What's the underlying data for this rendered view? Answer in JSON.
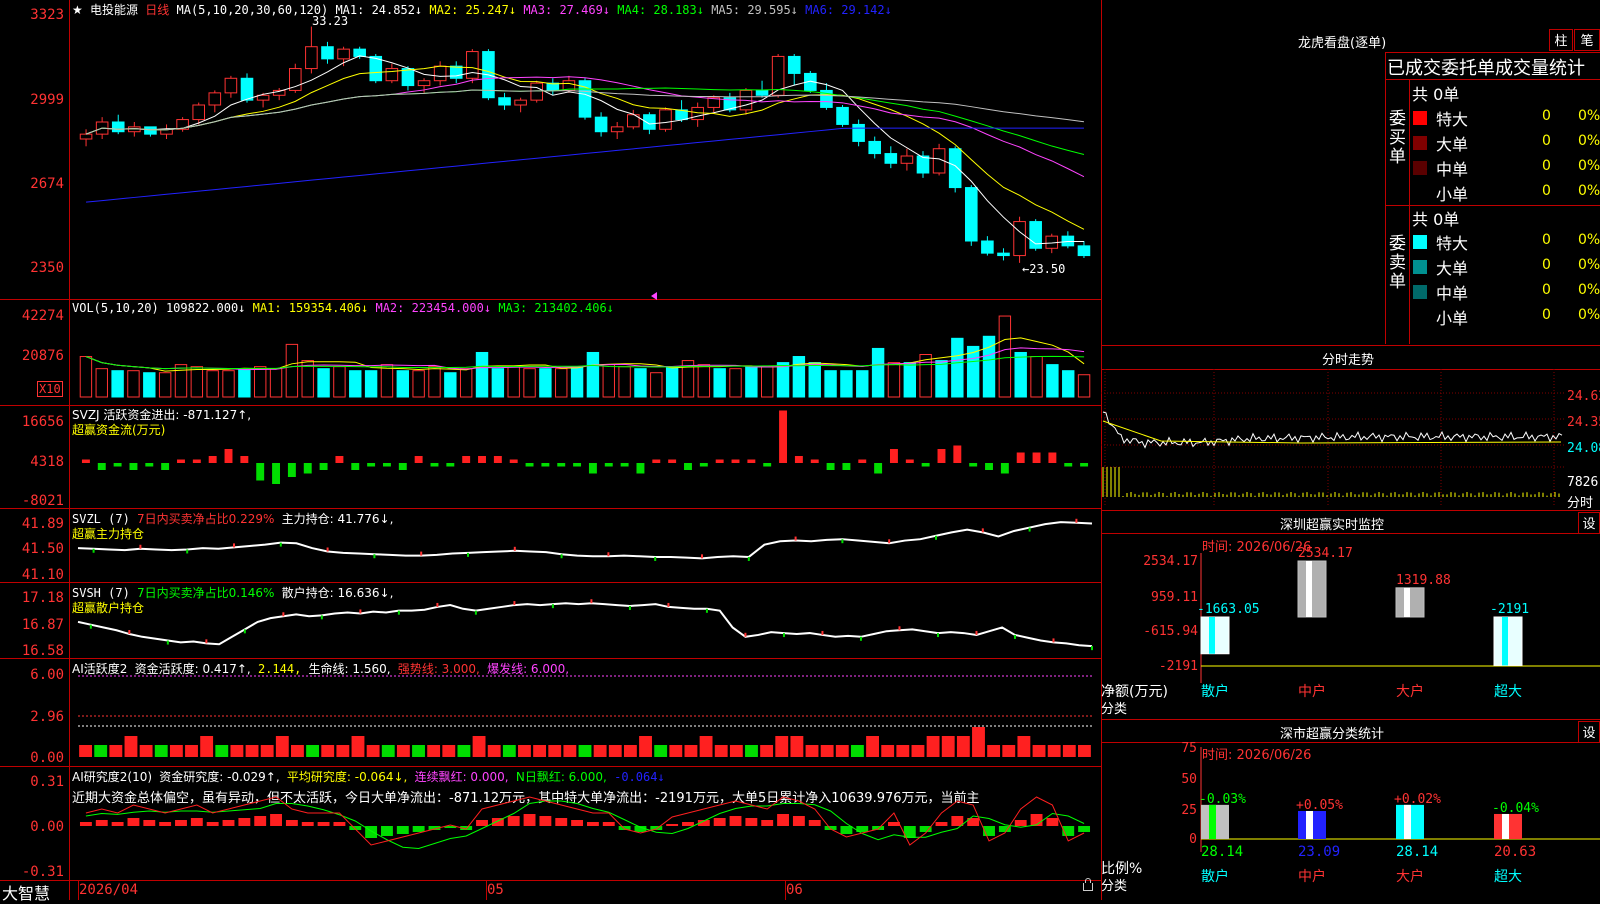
{
  "header": {
    "star": "★",
    "stock_name": "电投能源",
    "period": "日线",
    "ma_label": "MA(5,10,20,30,60,120)",
    "mas": [
      {
        "label": "MA1: 24.852↓",
        "color": "#ffffff"
      },
      {
        "label": "MA2: 25.247↓",
        "color": "#ffff00"
      },
      {
        "label": "MA3: 27.469↓",
        "color": "#ff44ff"
      },
      {
        "label": "MA4: 28.183↓",
        "color": "#00ff00"
      },
      {
        "label": "MA5: 29.595↓",
        "color": "#c0c0c0"
      },
      {
        "label": "MA6: 29.142↓",
        "color": "#2222ff"
      }
    ]
  },
  "main_chart": {
    "y_labels": [
      "3323",
      "2999",
      "2674",
      "2350"
    ],
    "high_mark": "33.23",
    "low_mark": "←23.50",
    "colors": {
      "up": "#ff3333",
      "down": "#00ffff",
      "ma1": "#ffffff",
      "ma2": "#ffff00",
      "ma3": "#ff44ff",
      "ma4": "#00ff00",
      "ma5": "#c0c0c0",
      "ma6": "#2222ff"
    }
  },
  "chart_data": {
    "type": "candlestick",
    "candles": [
      [
        28.6,
        29.0,
        28.3,
        28.8
      ],
      [
        28.8,
        29.5,
        28.6,
        29.3
      ],
      [
        29.3,
        29.6,
        28.8,
        28.9
      ],
      [
        28.9,
        29.3,
        28.7,
        29.1
      ],
      [
        29.1,
        29.1,
        28.7,
        28.8
      ],
      [
        28.8,
        29.2,
        28.6,
        29.0
      ],
      [
        29.0,
        29.5,
        28.9,
        29.4
      ],
      [
        29.4,
        30.1,
        29.2,
        30.0
      ],
      [
        30.0,
        30.6,
        29.7,
        30.5
      ],
      [
        30.5,
        31.2,
        30.3,
        31.1
      ],
      [
        31.1,
        31.3,
        30.1,
        30.2
      ],
      [
        30.2,
        30.5,
        29.9,
        30.4
      ],
      [
        30.4,
        30.7,
        30.2,
        30.6
      ],
      [
        30.6,
        31.7,
        30.5,
        31.5
      ],
      [
        31.5,
        33.23,
        31.3,
        32.4
      ],
      [
        32.4,
        32.6,
        31.7,
        31.9
      ],
      [
        31.9,
        32.4,
        31.6,
        32.3
      ],
      [
        32.3,
        32.4,
        31.9,
        32.0
      ],
      [
        32.0,
        32.1,
        30.9,
        31.0
      ],
      [
        31.0,
        31.7,
        30.9,
        31.5
      ],
      [
        31.5,
        31.6,
        30.6,
        30.8
      ],
      [
        30.8,
        31.1,
        30.5,
        31.0
      ],
      [
        31.0,
        31.8,
        30.8,
        31.6
      ],
      [
        31.6,
        31.8,
        30.9,
        31.1
      ],
      [
        31.1,
        32.3,
        30.9,
        32.2
      ],
      [
        32.2,
        32.3,
        30.2,
        30.3
      ],
      [
        30.3,
        30.5,
        29.8,
        30.0
      ],
      [
        30.0,
        30.3,
        29.7,
        30.2
      ],
      [
        30.2,
        31.0,
        30.1,
        30.9
      ],
      [
        30.9,
        31.1,
        30.4,
        30.6
      ],
      [
        30.6,
        31.2,
        30.5,
        31.0
      ],
      [
        31.0,
        31.1,
        29.4,
        29.5
      ],
      [
        29.5,
        29.7,
        28.7,
        28.9
      ],
      [
        28.9,
        29.3,
        28.6,
        29.1
      ],
      [
        29.1,
        29.8,
        29.0,
        29.6
      ],
      [
        29.6,
        29.7,
        28.8,
        29.0
      ],
      [
        29.0,
        29.9,
        28.9,
        29.8
      ],
      [
        29.8,
        30.2,
        29.3,
        29.4
      ],
      [
        29.4,
        30.1,
        29.1,
        29.9
      ],
      [
        29.9,
        30.4,
        29.7,
        30.3
      ],
      [
        30.3,
        30.5,
        29.7,
        29.8
      ],
      [
        29.8,
        30.7,
        29.6,
        30.6
      ],
      [
        30.6,
        31.0,
        30.3,
        30.4
      ],
      [
        30.4,
        32.1,
        30.3,
        32.0
      ],
      [
        32.0,
        32.1,
        30.8,
        31.3
      ],
      [
        31.3,
        31.4,
        30.5,
        30.6
      ],
      [
        30.6,
        30.9,
        29.8,
        29.9
      ],
      [
        29.9,
        30.0,
        29.1,
        29.2
      ],
      [
        29.2,
        29.4,
        28.3,
        28.5
      ],
      [
        28.5,
        28.7,
        27.8,
        28.0
      ],
      [
        28.0,
        28.3,
        27.4,
        27.6
      ],
      [
        27.6,
        28.2,
        27.3,
        27.9
      ],
      [
        27.9,
        28.1,
        27.0,
        27.2
      ],
      [
        27.2,
        28.4,
        27.1,
        28.2
      ],
      [
        28.2,
        28.3,
        26.4,
        26.6
      ],
      [
        26.6,
        26.7,
        24.2,
        24.4
      ],
      [
        24.4,
        24.6,
        23.8,
        23.9
      ],
      [
        23.9,
        24.1,
        23.6,
        23.8
      ],
      [
        23.8,
        25.4,
        23.5,
        25.2
      ],
      [
        25.2,
        25.3,
        24.0,
        24.1
      ],
      [
        24.1,
        24.7,
        23.9,
        24.6
      ],
      [
        24.6,
        24.8,
        24.1,
        24.2
      ],
      [
        24.2,
        24.4,
        23.7,
        23.8
      ]
    ],
    "y_range": [
      23.0,
      33.5
    ]
  },
  "vol": {
    "label": "VOL(5,10,20)",
    "items": [
      {
        "text": "109822.000↓",
        "color": "#ffffff"
      },
      {
        "text": "MA1: 159354.406↓",
        "color": "#ffff00"
      },
      {
        "text": "MA2: 223454.000↓",
        "color": "#ff44ff"
      },
      {
        "text": "MA3: 213402.406↓",
        "color": "#00ff00"
      }
    ],
    "y_labels": [
      "42274",
      "20876"
    ],
    "unit": "X10",
    "values": [
      20,
      14,
      13,
      13,
      12,
      12,
      16,
      15,
      13,
      13,
      14,
      15,
      14,
      26,
      18,
      14,
      15,
      13,
      13,
      16,
      13,
      13,
      15,
      12,
      14,
      22,
      14,
      15,
      14,
      14,
      14,
      15,
      22,
      16,
      15,
      14,
      12,
      15,
      18,
      16,
      14,
      14,
      15,
      15,
      17,
      20,
      17,
      13,
      13,
      13,
      24,
      17,
      17,
      21,
      18,
      29,
      25,
      30,
      40,
      22,
      20,
      16,
      13,
      11
    ]
  },
  "svzj": {
    "label": "SVZJ  活跃资金进出: -871.127↑,",
    "sub": "超赢资金流(万元)",
    "y_labels": [
      "16656",
      "4318",
      "-8021"
    ],
    "values": [
      1,
      -2,
      -1,
      -2,
      -1,
      -2,
      1,
      1,
      2,
      4,
      2,
      -5,
      -6,
      -4,
      -3,
      -2,
      2,
      -2,
      -1,
      -1,
      -2,
      2,
      -1,
      -1,
      2,
      2,
      2,
      1,
      -1,
      -1,
      -1,
      -1,
      -3,
      -1,
      -1,
      -3,
      1,
      1,
      -2,
      -1,
      1,
      1,
      1,
      -1,
      15,
      2,
      1,
      -2,
      -2,
      1,
      -3,
      4,
      1,
      -1,
      4,
      5,
      -1,
      -2,
      -3,
      3,
      3,
      3,
      -1,
      -1
    ]
  },
  "svzl": {
    "label": "SVZL (7)",
    "ratio": "7日内买卖净占比0.229%",
    "pos": "主力持仓: 41.776↓,",
    "sub": "超赢主力持仓",
    "y_labels": [
      "41.89",
      "41.50",
      "41.10"
    ],
    "values": [
      41.45,
      41.44,
      41.43,
      41.42,
      41.44,
      41.43,
      41.42,
      41.43,
      41.45,
      41.44,
      41.46,
      41.48,
      41.5,
      41.53,
      41.52,
      41.45,
      41.4,
      41.38,
      41.37,
      41.36,
      41.35,
      41.34,
      41.34,
      41.35,
      41.37,
      41.38,
      41.39,
      41.4,
      41.41,
      41.4,
      41.39,
      41.36,
      41.34,
      41.33,
      41.33,
      41.34,
      41.33,
      41.32,
      41.32,
      41.31,
      41.3,
      41.32,
      41.33,
      41.32,
      41.5,
      41.55,
      41.56,
      41.55,
      41.57,
      41.58,
      41.56,
      41.54,
      41.52,
      41.56,
      41.58,
      41.63,
      41.68,
      41.72,
      41.68,
      41.62,
      41.7,
      41.75,
      41.8,
      41.83,
      41.82,
      41.81
    ]
  },
  "svsh": {
    "label": "SVSH (7)",
    "ratio": "7日内买卖净占比0.146%",
    "pos": "散户持仓: 16.636↓,",
    "sub": "超赢散户持仓",
    "y_labels": [
      "17.18",
      "16.87",
      "16.58"
    ],
    "values": [
      16.86,
      16.83,
      16.8,
      16.77,
      16.73,
      16.7,
      16.68,
      16.66,
      16.64,
      16.65,
      16.63,
      16.62,
      16.7,
      16.78,
      16.86,
      16.9,
      16.92,
      16.94,
      16.92,
      16.93,
      16.95,
      16.96,
      16.95,
      16.97,
      16.96,
      16.98,
      16.98,
      16.99,
      17.02,
      17.04,
      17.0,
      16.98,
      17.0,
      17.02,
      17.04,
      17.05,
      17.04,
      17.05,
      17.06,
      17.05,
      17.06,
      17.05,
      17.04,
      17.03,
      17.04,
      17.05,
      17.02,
      17.01,
      17.0,
      17.0,
      16.98,
      16.8,
      16.7,
      16.72,
      16.75,
      16.74,
      16.73,
      16.74,
      16.72,
      16.7,
      16.71,
      16.7,
      16.73,
      16.76,
      16.77,
      16.78,
      16.76,
      16.74,
      16.75,
      16.74,
      16.72,
      16.76,
      16.8,
      16.72,
      16.69,
      16.66,
      16.64,
      16.63,
      16.61,
      16.6
    ]
  },
  "ai_active": {
    "label": "AI活跃度2",
    "items": [
      {
        "text": "资金活跃度: 0.417↑,",
        "color": "#ffffff"
      },
      {
        "text": "2.144,",
        "color": "#ffff00"
      },
      {
        "text": "生命线: 1.560,",
        "color": "#ffffff"
      },
      {
        "text": "强势线: 3.000,",
        "color": "#ff3333"
      },
      {
        "text": "爆发线: 6.000,",
        "color": "#ff44ff"
      }
    ],
    "y_labels": [
      "6.00",
      "2.96",
      "0.00"
    ],
    "values": [
      1,
      -1,
      1,
      2,
      1,
      -1,
      1,
      1,
      2,
      -1,
      1,
      1,
      1,
      2,
      1,
      -1,
      1,
      1,
      2,
      1,
      -1,
      1,
      -1,
      1,
      1,
      -1,
      2,
      1,
      -1,
      1,
      1,
      1,
      1,
      -1,
      1,
      1,
      1,
      2,
      -1,
      1,
      1,
      2,
      1,
      1,
      -1,
      1,
      2,
      2,
      1,
      1,
      1,
      -1,
      2,
      1,
      1,
      1,
      2,
      2,
      2,
      3,
      1,
      1,
      2,
      1,
      1,
      1,
      1
    ]
  },
  "ai_research": {
    "label": "AI研究度2(10)",
    "items": [
      {
        "text": "资金研究度: -0.029↑,",
        "color": "#ffffff"
      },
      {
        "text": "平均研究度: -0.064↓,",
        "color": "#ffff00"
      },
      {
        "text": "连续飘红: 0.000,",
        "color": "#ff44ff"
      },
      {
        "text": "N日飘红: 6.000,",
        "color": "#00ff00"
      },
      {
        "text": "-0.064↓",
        "color": "#2222ff"
      }
    ],
    "y_labels": [
      "0.31",
      "0.00",
      "-0.31"
    ],
    "comment": "近期大资金总体偏空，虽有异动，但不太活跃，今日大单净流出：-871.12万元，其中特大单净流出：-2191万元，大单5日累计净入10639.976万元，当前主",
    "values": [
      0.02,
      0.03,
      0.02,
      0.04,
      0.03,
      0.02,
      0.03,
      0.04,
      0.02,
      0.03,
      0.04,
      0.05,
      0.06,
      0.03,
      0.02,
      0.02,
      0.02,
      -0.02,
      -0.06,
      -0.05,
      -0.04,
      -0.03,
      -0.02,
      -0.01,
      -0.02,
      0.03,
      0.04,
      0.05,
      0.06,
      0.05,
      0.04,
      0.03,
      0.02,
      0.02,
      -0.02,
      -0.03,
      -0.02,
      0.01,
      0.02,
      0.03,
      0.04,
      0.05,
      0.04,
      0.03,
      0.06,
      0.05,
      0.03,
      -0.02,
      -0.04,
      -0.03,
      -0.02,
      0.02,
      -0.06,
      -0.03,
      0.02,
      0.05,
      0.04,
      -0.05,
      -0.03,
      0.03,
      0.06,
      0.04,
      -0.05,
      -0.03
    ]
  },
  "x_axis": {
    "labels": [
      "2026/04",
      "05",
      "06"
    ]
  },
  "footer": {
    "app": "大智慧"
  },
  "right": {
    "lhb": {
      "title": "龙虎看盘(逐单)",
      "btn1": "柱",
      "btn2": "笔",
      "header": "已成交委托单成交量统计",
      "buy_label": "委买单",
      "sell_label": "委卖单",
      "buy_total": "共 0单",
      "sell_total": "共 0单",
      "buy_rows": [
        {
          "name": "特大",
          "val": "0",
          "pct": "0%",
          "color": "#ff0000"
        },
        {
          "name": "大单",
          "val": "0",
          "pct": "0%",
          "color": "#800000"
        },
        {
          "name": "中单",
          "val": "0",
          "pct": "0%",
          "color": "#5a0000"
        },
        {
          "name": "小单",
          "val": "0",
          "pct": "0%",
          "color": "#000000"
        }
      ],
      "sell_rows": [
        {
          "name": "特大",
          "val": "0",
          "pct": "0%",
          "color": "#00ffff"
        },
        {
          "name": "大单",
          "val": "0",
          "pct": "0%",
          "color": "#009090"
        },
        {
          "name": "中单",
          "val": "0",
          "pct": "0%",
          "color": "#006a6a"
        },
        {
          "name": "小单",
          "val": "0",
          "pct": "0%",
          "color": "#000000"
        }
      ]
    },
    "fenshi": {
      "title": "分时走势",
      "labels": [
        "24.62",
        "24.35",
        "24.08"
      ],
      "vol_label": "7826",
      "sub": "分时"
    },
    "sz_monitor": {
      "title": "深圳超赢实时监控",
      "btn": "设",
      "time": "时间: 2026/06/26",
      "y_labels": [
        "2534.17",
        "959.11",
        "-615.94",
        "-2191"
      ],
      "bars": [
        {
          "cat": "散户",
          "value": "-1663.05"
        },
        {
          "cat": "中户",
          "value": "2534.17"
        },
        {
          "cat": "大户",
          "value": "1319.88"
        },
        {
          "cat": "超大",
          "value": "-2191"
        }
      ],
      "axis_name": "净额(万元)",
      "axis_cat": "分类"
    },
    "sz_class": {
      "title": "深市超赢分类统计",
      "btn": "设",
      "time": "时间: 2026/06/26",
      "y_labels": [
        "75",
        "50",
        "25",
        "0"
      ],
      "bars": [
        {
          "cat": "散户",
          "pct": "-0.03%",
          "val": "28.14"
        },
        {
          "cat": "中户",
          "pct": "+0.05%",
          "val": "23.09"
        },
        {
          "cat": "大户",
          "pct": "+0.02%",
          "val": "28.14"
        },
        {
          "cat": "超大",
          "pct": "-0.04%",
          "val": "20.63"
        }
      ],
      "axis_name": "比例%",
      "axis_cat": "分类"
    }
  }
}
